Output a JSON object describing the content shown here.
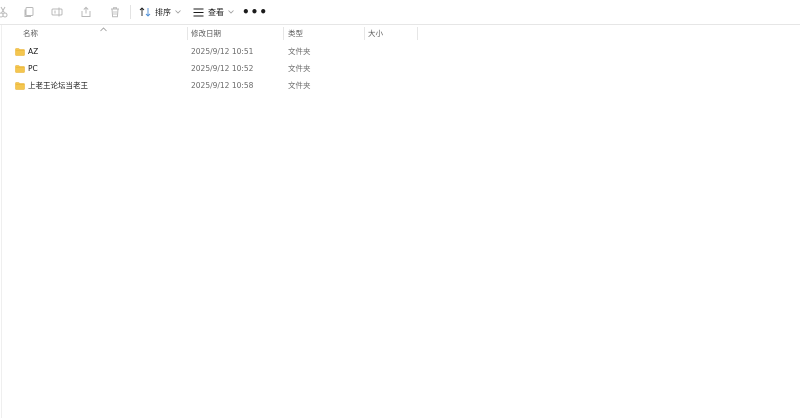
{
  "toolbar": {
    "buttons": [
      {
        "icon": "cut-icon"
      },
      {
        "icon": "copy-icon"
      },
      {
        "icon": "rename-icon"
      },
      {
        "icon": "share-icon"
      },
      {
        "icon": "delete-icon"
      }
    ],
    "sort_label": "排序",
    "view_label": "查看",
    "more_label": "•••"
  },
  "columns": {
    "name": "名称",
    "modified": "修改日期",
    "type": "类型",
    "size": "大小"
  },
  "files": [
    {
      "name": "AZ",
      "modified": "2025/9/12 10:51",
      "type": "文件夹",
      "icon": "folder-icon"
    },
    {
      "name": "PC",
      "modified": "2025/9/12 10:52",
      "type": "文件夹",
      "icon": "folder-icon"
    },
    {
      "name": "上老王论坛当老王",
      "modified": "2025/9/12 10:58",
      "type": "文件夹",
      "icon": "folder-icon"
    }
  ],
  "colors": {
    "folder": "#f4c64f",
    "folder_dark": "#e8ad2b",
    "text": "#1b1b1b",
    "muted": "#6a6a6a",
    "divider": "#e6e6e6"
  }
}
